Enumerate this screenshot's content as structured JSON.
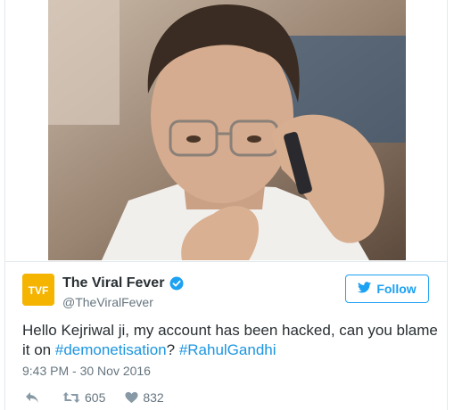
{
  "author": {
    "display_name": "The Viral Fever",
    "handle": "@TheViralFever",
    "avatar_text": "TVF"
  },
  "follow_button": {
    "label": "Follow"
  },
  "tweet": {
    "text_before": "Hello Kejriwal ji, my account has been hacked, can you blame it on ",
    "hashtag_1": "#demonetisation",
    "text_middle": "? ",
    "hashtag_2": "#RahulGandhi",
    "timestamp": "9:43 PM - 30 Nov 2016"
  },
  "actions": {
    "retweet_count": "605",
    "like_count": "832"
  },
  "colors": {
    "accent": "#1da1f2",
    "hashtag": "#1b95e0",
    "text": "#292f33",
    "muted": "#66757f",
    "avatar_bg": "#f4b400"
  },
  "icons": [
    "verified-icon",
    "twitter-bird-icon",
    "reply-icon",
    "retweet-icon",
    "heart-icon"
  ]
}
